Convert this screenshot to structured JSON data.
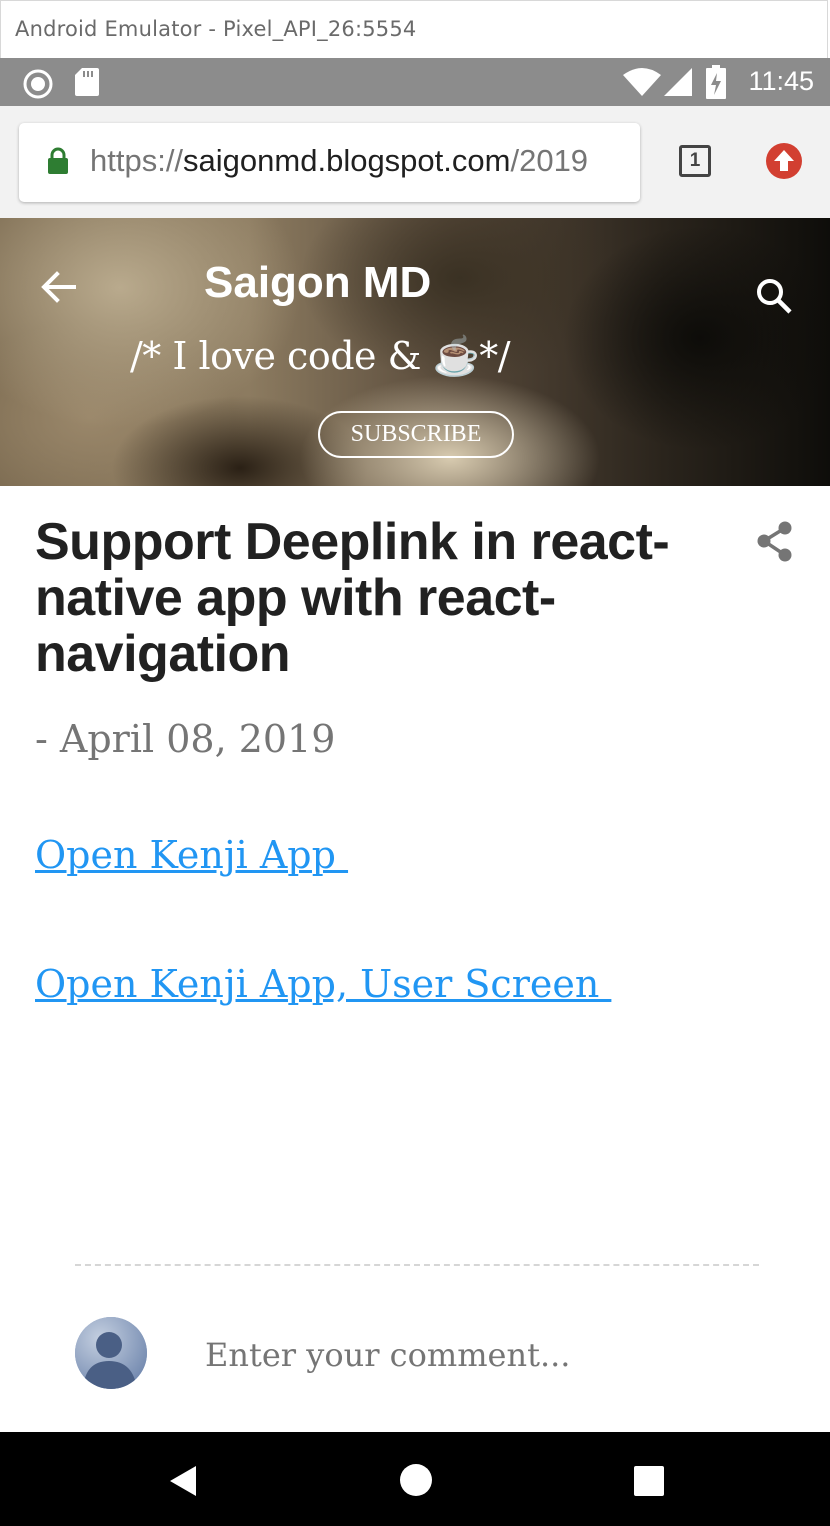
{
  "window": {
    "title": "Android Emulator - Pixel_API_26:5554"
  },
  "status_bar": {
    "time": "11:45",
    "icons": [
      "record-icon",
      "sdcard-icon",
      "wifi-icon",
      "signal-icon",
      "battery-charging-icon"
    ]
  },
  "browser": {
    "url_scheme": "https://",
    "url_host": "saigonmd.blogspot.com",
    "url_path": "/2019",
    "tab_count": "1",
    "icons": [
      "lock-icon",
      "tabs-icon",
      "update-icon"
    ],
    "accent_secure": "#2e7d32",
    "accent_update": "#d23f31"
  },
  "blog": {
    "title": "Saigon MD",
    "tagline": "/* I love code & ☕*/",
    "subscribe_label": "SUBSCRIBE",
    "icons": [
      "back-arrow-icon",
      "search-icon"
    ]
  },
  "post": {
    "title": "Support Deeplink in react-native app with react-navigation",
    "date": "- April 08, 2019",
    "links": [
      "Open Kenji App ",
      "Open Kenji App, User Screen "
    ],
    "link_color": "#2196f3",
    "icons": [
      "share-icon"
    ]
  },
  "comments": {
    "placeholder": "Enter your comment..."
  },
  "nav_bar": {
    "icons": [
      "nav-back-icon",
      "nav-home-icon",
      "nav-recents-icon"
    ]
  }
}
